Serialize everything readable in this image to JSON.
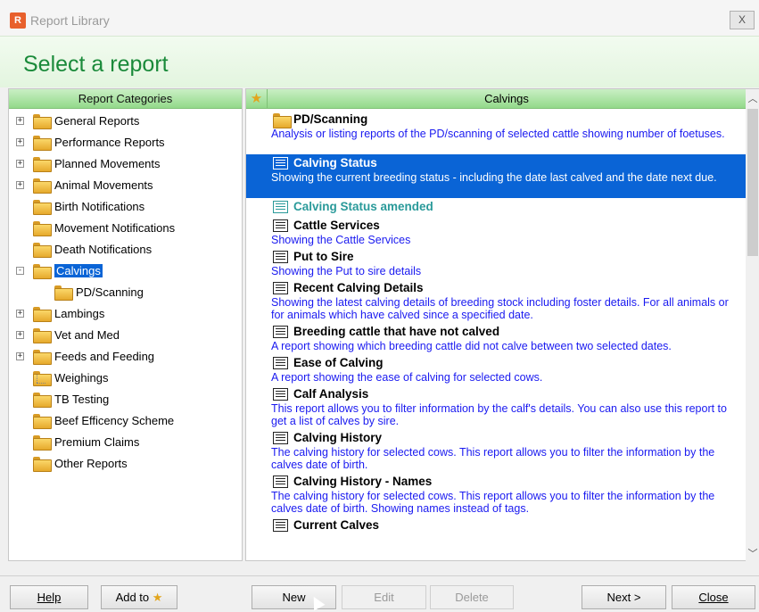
{
  "window": {
    "title": "Report Library",
    "close_glyph": "X"
  },
  "header": {
    "heading": "Select a report"
  },
  "categories": {
    "header": "Report Categories",
    "items": [
      {
        "label": "General Reports",
        "expander": "+"
      },
      {
        "label": "Performance Reports",
        "expander": "+"
      },
      {
        "label": "Planned Movements",
        "expander": "+"
      },
      {
        "label": "Animal Movements",
        "expander": "+"
      },
      {
        "label": "Birth Notifications",
        "expander": ""
      },
      {
        "label": "Movement Notifications",
        "expander": ""
      },
      {
        "label": "Death Notifications",
        "expander": ""
      },
      {
        "label": "Calvings",
        "expander": "-",
        "selected": true
      },
      {
        "label": "PD/Scanning",
        "expander": "",
        "child": true
      },
      {
        "label": "Lambings",
        "expander": "+"
      },
      {
        "label": "Vet and Med",
        "expander": "+"
      },
      {
        "label": "Feeds and Feeding",
        "expander": "+"
      },
      {
        "label": "Weighings",
        "expander": ""
      },
      {
        "label": "TB Testing",
        "expander": ""
      },
      {
        "label": "Beef Efficency Scheme",
        "expander": ""
      },
      {
        "label": "Premium Claims",
        "expander": ""
      },
      {
        "label": "Other Reports",
        "expander": ""
      }
    ]
  },
  "reports": {
    "header": "Calvings",
    "favourite_icon": "star-icon",
    "items": [
      {
        "title": "PD/Scanning",
        "icon": "folder-icon",
        "desc": "Analysis or listing reports of the PD/scanning of selected cattle showing number of foetuses."
      },
      {
        "title": "Calving Status",
        "icon": "report-icon",
        "desc": "Showing the current breeding status - including the date last calved and the date next due.",
        "selected": true
      },
      {
        "title": "Calving Status amended",
        "icon": "report-icon",
        "desc": "",
        "amended": true
      },
      {
        "title": "Cattle Services",
        "icon": "report-icon",
        "desc": "Showing the Cattle Services"
      },
      {
        "title": "Put to Sire",
        "icon": "report-icon",
        "desc": "Showing the Put to sire details"
      },
      {
        "title": "Recent Calving Details",
        "icon": "report-icon",
        "desc": "Showing the latest calving details of breeding stock including foster details. For all animals or for animals which have calved since a specified date."
      },
      {
        "title": "Breeding cattle that have not calved",
        "icon": "report-icon",
        "desc": "A report showing which breeding cattle did not calve between two selected dates."
      },
      {
        "title": "Ease of Calving",
        "icon": "report-icon",
        "desc": "A report showing the ease of calving for selected cows."
      },
      {
        "title": "Calf Analysis",
        "icon": "report-icon",
        "desc": "This report allows you to filter information by the calf's details. You can also use this report to get a list of calves by sire."
      },
      {
        "title": "Calving History",
        "icon": "report-icon",
        "desc": "The calving history for selected cows. This report allows you to filter the information by the calves date of birth."
      },
      {
        "title": "Calving History - Names",
        "icon": "report-icon",
        "desc": "The calving history for selected cows. This report allows you to filter the information by the calves date of birth. Showing names instead of tags."
      },
      {
        "title": "Current Calves",
        "icon": "report-icon",
        "desc": ""
      }
    ]
  },
  "buttons": {
    "help": "Help",
    "add_to": "Add to",
    "new": "New",
    "edit": "Edit",
    "delete": "Delete",
    "next": "Next >",
    "close": "Close"
  },
  "colors": {
    "accent_green": "#1a8a3a",
    "selection_blue": "#0a64d6",
    "description_blue": "#1a1af0"
  }
}
